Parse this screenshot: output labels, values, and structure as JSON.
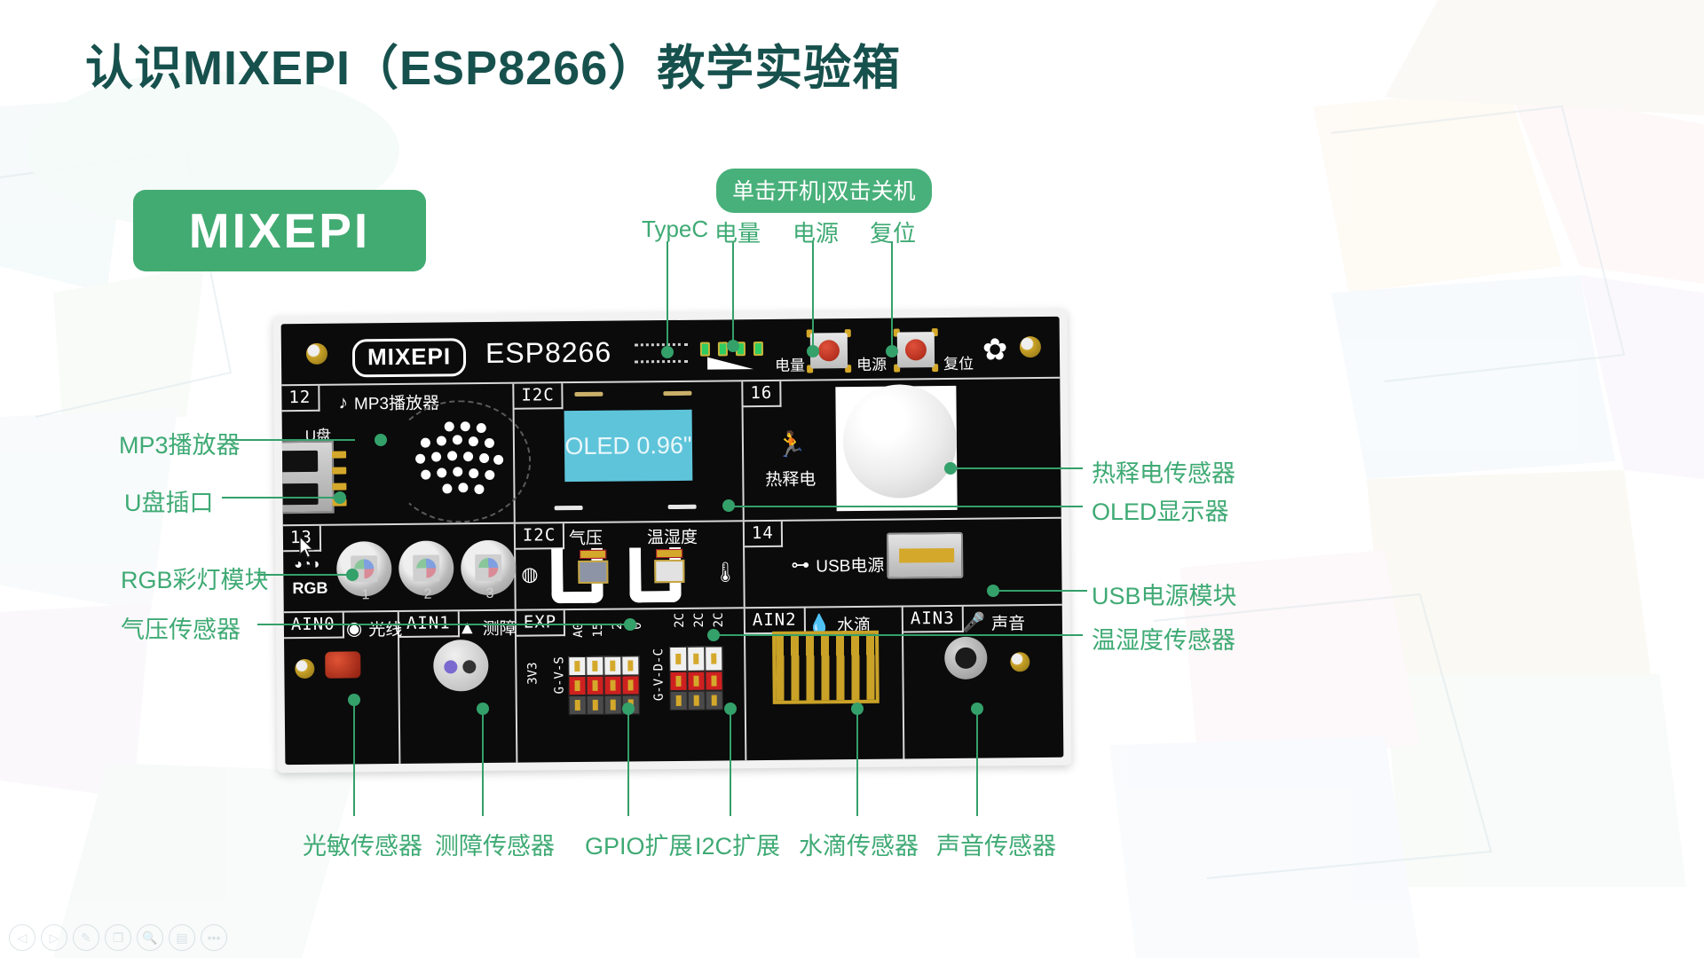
{
  "page_title": "认识MIXEPI（ESP8266）教学实验箱",
  "brand_badge": "MIXEPI",
  "colors": {
    "title": "#17514d",
    "brand_green": "#42ab72",
    "callout_green": "#3faa74",
    "pcb_black": "#0b0b0b",
    "oled_cyan": "#5ec4da"
  },
  "top_annotations": {
    "power_hint_pill": "单击开机|双击关机",
    "labels": [
      "TypeC",
      "电量",
      "电源",
      "复位"
    ]
  },
  "board": {
    "header": {
      "chip_name": "MIXEPI",
      "mcu": "ESP8266",
      "battery_label": "电量",
      "power_label": "电源",
      "reset_label": "复位"
    },
    "cells": {
      "mp3": {
        "tag": "12",
        "icon": "music-note-icon",
        "title": "MP3播放器",
        "usb_label": "U盘"
      },
      "oled": {
        "tag": "I2C",
        "screen_text": "OLED 0.96\""
      },
      "pir": {
        "tag": "16",
        "icon": "running-person-icon",
        "title": "热释电"
      },
      "rgb": {
        "tag": "13",
        "title": "RGB",
        "led_numbers": [
          "1",
          "2",
          "3"
        ]
      },
      "env": {
        "tag": "I2C",
        "pressure_title": "气压",
        "humid_title": "温湿度"
      },
      "usbpower": {
        "tag": "14",
        "icon": "usb-icon",
        "title": "USB电源"
      },
      "light": {
        "tag": "AIN0",
        "icon": "eye-icon",
        "title": "光线"
      },
      "obstacle": {
        "tag": "AIN1",
        "icon": "cone-icon",
        "title": "测障"
      },
      "exp": {
        "tag": "EXP",
        "voltage_label": "3V3",
        "gpio_side_label": "G-V-S",
        "gpio_pin_labels": [
          "A0",
          "15",
          "2",
          "0"
        ],
        "i2c_side_label": "G-V-D-C",
        "i2c_pin_labels": [
          "2C",
          "2C",
          "2C"
        ]
      },
      "water": {
        "tag": "AIN2",
        "icon": "water-drop-icon",
        "title": "水滴"
      },
      "sound": {
        "tag": "AIN3",
        "icon": "microphone-icon",
        "title": "声音"
      }
    }
  },
  "callouts": {
    "left": [
      "MP3播放器",
      "U盘插口",
      "RGB彩灯模块",
      "气压传感器"
    ],
    "right": [
      "热释电传感器",
      "OLED显示器",
      "USB电源模块",
      "温湿度传感器"
    ],
    "bottom": [
      "光敏传感器",
      "测障传感器",
      "GPIO扩展",
      "I2C扩展",
      "水滴传感器",
      "声音传感器"
    ]
  },
  "toolbar": [
    {
      "name": "previous-slide-button",
      "glyph": "◁"
    },
    {
      "name": "next-slide-button",
      "glyph": "▷"
    },
    {
      "name": "pen-tool-button",
      "glyph": "✎"
    },
    {
      "name": "slides-overview-button",
      "glyph": "❐"
    },
    {
      "name": "zoom-button",
      "glyph": "🔍"
    },
    {
      "name": "notes-button",
      "glyph": "▤"
    },
    {
      "name": "more-options-button",
      "glyph": "•••"
    }
  ]
}
